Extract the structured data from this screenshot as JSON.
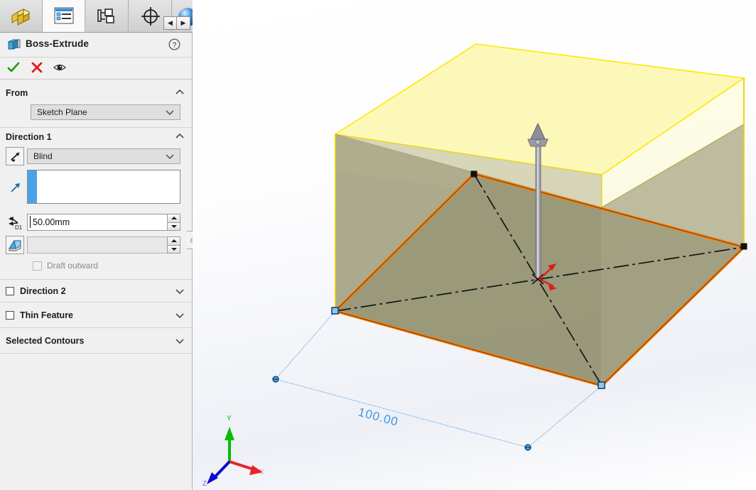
{
  "panel": {
    "tabs": [
      {
        "name": "feature-manager-tree-tab",
        "icon": "yellow-part-icon",
        "active": false
      },
      {
        "name": "property-manager-tab",
        "icon": "property-list-icon",
        "active": true
      },
      {
        "name": "configuration-manager-tab",
        "icon": "configuration-tree-icon",
        "active": false
      },
      {
        "name": "dimxpert-manager-tab",
        "icon": "crosshair-target-icon",
        "active": false
      },
      {
        "name": "display-manager-tab",
        "icon": "blue-sphere-icon",
        "active": false
      }
    ],
    "tab_nav": {
      "prev": "◀",
      "next": "▶"
    },
    "feature": {
      "icon": "boss-extrude-icon",
      "title": "Boss-Extrude",
      "help_label": "?",
      "ok_label": "✓",
      "cancel_label": "✕",
      "preview_label": "eye"
    },
    "sections": {
      "from": {
        "title": "From",
        "collapsed": false,
        "start_condition": "Sketch Plane"
      },
      "direction1": {
        "title": "Direction 1",
        "collapsed": false,
        "reverse_direction_icon": "reverse-direction-arrow",
        "end_condition": "Blind",
        "direction_vector_icon": "direction-arrow-icon",
        "direction_vector_value": "",
        "depth_icon": "depth-d1-icon",
        "depth_value": "50.00mm",
        "draft_icon": "draft-angle-icon",
        "draft_value": "",
        "draft_outward_label": "Draft outward",
        "draft_outward_checked": false
      },
      "direction2": {
        "title": "Direction 2",
        "checked": false,
        "collapsed": true
      },
      "thin_feature": {
        "title": "Thin Feature",
        "checked": false,
        "collapsed": true
      },
      "selected_contours": {
        "title": "Selected Contours",
        "collapsed": true
      }
    }
  },
  "graphics": {
    "dimension_label": "100.00",
    "triad": {
      "x_label": "X",
      "y_label": "Y",
      "z_label": "Z",
      "x_color": "#e8232a",
      "y_color": "#00c000",
      "z_color": "#0a0ad0"
    },
    "colors": {
      "preview_fill": "#fcf7b0",
      "preview_edge": "#ffe800",
      "solid_fill": "#a8a684",
      "selected_edge": "#ff7b00",
      "sketch_line": "#4aa0e8",
      "centerline": "#111111",
      "handle_gray": "#8c8c93",
      "arrow_red": "#e01b17"
    }
  }
}
